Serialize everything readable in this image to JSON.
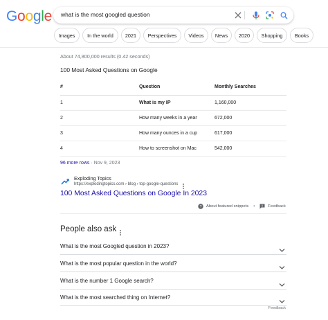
{
  "logo": {
    "letters": [
      "G",
      "o",
      "o",
      "g",
      "l",
      "e"
    ]
  },
  "search": {
    "query": "what is the most googled question"
  },
  "icons": {
    "clear": "close-icon",
    "voice": "microphone-icon",
    "lens": "camera-lens-icon",
    "search": "search-icon"
  },
  "chips": [
    "Images",
    "In the world",
    "2021",
    "Perspectives",
    "Videos",
    "News",
    "2020",
    "Shopping",
    "Books"
  ],
  "results": {
    "stats": "About 74,800,000 results (0.42 seconds)"
  },
  "featured_snippet": {
    "title": "100 Most Asked Questions on Google",
    "table": {
      "headers": [
        "#",
        "Question",
        "Monthly Searches"
      ],
      "rows": [
        [
          "1",
          "What is my IP",
          "1,160,000"
        ],
        [
          "2",
          "How many weeks in a year",
          "672,000"
        ],
        [
          "3",
          "How many ounces in a cup",
          "617,000"
        ],
        [
          "4",
          "How to screenshot on Mac",
          "542,000"
        ]
      ]
    },
    "more_rows": "96 more rows",
    "date": " · Nov 9, 2023",
    "source": {
      "name": "Exploding Topics",
      "url": "https://explodingtopics.com › blog › top-google-questions"
    },
    "result_title": "100 Most Asked Questions on Google In 2023",
    "about_label": "About featured snippets",
    "separator": "•",
    "feedback_label": "Feedback"
  },
  "people_also_ask": {
    "title": "People also ask",
    "questions": [
      "What is the most Googled question in 2023?",
      "What is the most popular question in the world?",
      "What is the number 1 Google search?",
      "What is the most searched thing on Internet?"
    ],
    "feedback_label": "Feedback"
  },
  "colors": {
    "link": "#1a0dab",
    "google_blue": "#4285f4",
    "google_red": "#ea4335",
    "google_yellow": "#fbbc05",
    "google_green": "#34a853"
  }
}
